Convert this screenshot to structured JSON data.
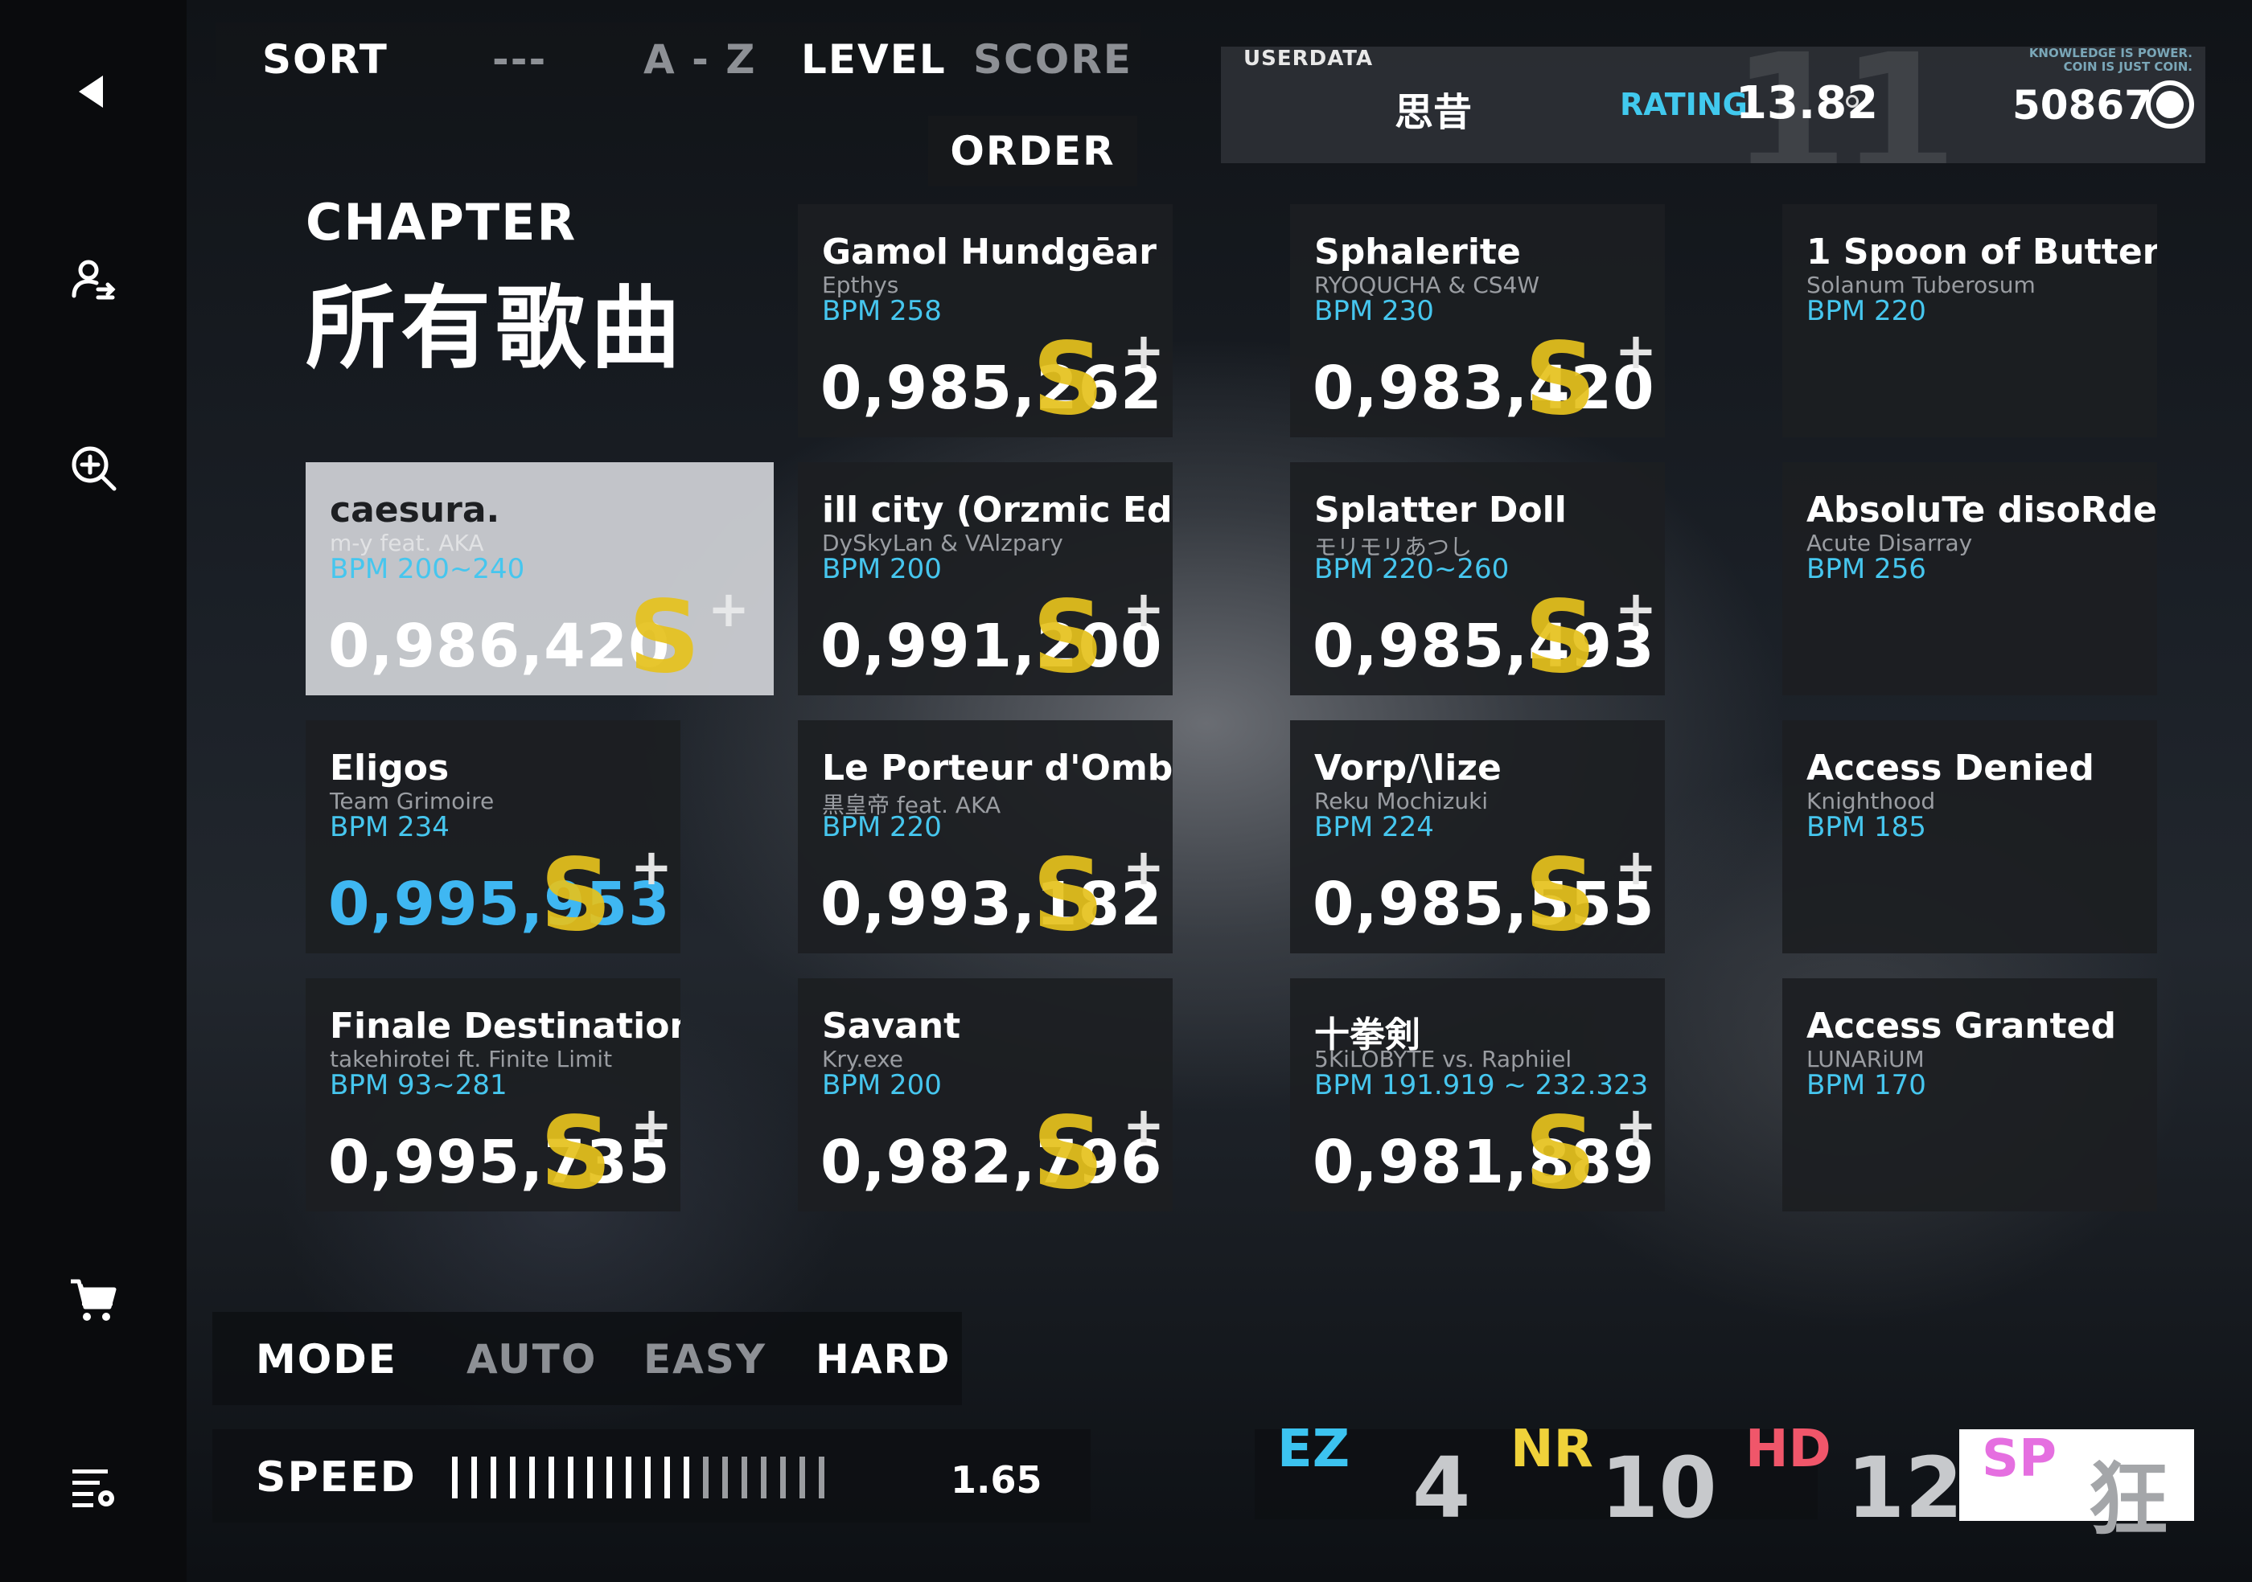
{
  "sidebar": {
    "icons": [
      "back-arrow-icon",
      "user-switch-icon",
      "zoom-in-icon",
      "cart-icon",
      "settings-list-icon"
    ]
  },
  "sort": {
    "label": "SORT",
    "options": [
      "---",
      "A - Z",
      "LEVEL",
      "SCORE"
    ],
    "active": "LEVEL",
    "order_label": "ORDER"
  },
  "userdata": {
    "label": "USERDATA",
    "name": "思昔",
    "rating_label": "RATING",
    "rating": "13.82",
    "background_level": "11",
    "motto_line1": "KNOWLEDGE IS POWER.",
    "motto_line2": "COIN IS JUST COIN.",
    "coins": "50867"
  },
  "chapter": {
    "label": "CHAPTER",
    "name": "所有歌曲"
  },
  "songs": [
    {
      "title": "Gamol Hundgēar",
      "artist": "Epthys",
      "bpm": "BPM 258",
      "score": "0,985,262",
      "rank": "S",
      "plus": "+"
    },
    {
      "title": "Sphalerite",
      "artist": "RYOQUCHA & CS4W",
      "bpm": "BPM 230",
      "score": "0,983,420",
      "rank": "S",
      "plus": "+"
    },
    {
      "title": "1 Spoon of Butter",
      "artist": "Solanum Tuberosum",
      "bpm": "BPM 220",
      "score": "",
      "rank": "",
      "plus": ""
    },
    {
      "title": "caesura.",
      "artist": "m-y feat. AKA",
      "bpm": "BPM 200~240",
      "score": "0,986,420",
      "rank": "S",
      "plus": "+"
    },
    {
      "title": "ill city (Orzmic Edit)",
      "artist": "DySkyLan & VAlzpary",
      "bpm": "BPM 200",
      "score": "0,991,200",
      "rank": "S",
      "plus": "+"
    },
    {
      "title": "Splatter Doll",
      "artist": "モリモリあつし",
      "bpm": "BPM 220~260",
      "score": "0,985,493",
      "rank": "S",
      "plus": "+"
    },
    {
      "title": "AbsoluTe disoRdeR",
      "artist": "Acute Disarray",
      "bpm": "BPM 256",
      "score": "",
      "rank": "",
      "plus": ""
    },
    {
      "title": "Eligos",
      "artist": "Team Grimoire",
      "bpm": "BPM 234",
      "score": "0,995,953",
      "rank": "S",
      "plus": "+"
    },
    {
      "title": "Le Porteur d'Ombre",
      "artist": "黒皇帝 feat. AKA",
      "bpm": "BPM 220",
      "score": "0,993,182",
      "rank": "S",
      "plus": "+"
    },
    {
      "title": "Vorp/\\lize",
      "artist": "Reku Mochizuki",
      "bpm": "BPM 224",
      "score": "0,985,555",
      "rank": "S",
      "plus": "+"
    },
    {
      "title": "Access Denied",
      "artist": "Knighthood",
      "bpm": "BPM 185",
      "score": "",
      "rank": "",
      "plus": ""
    },
    {
      "title": "Finale Destination",
      "artist": "takehirotei ft. Finite Limit",
      "bpm": "BPM 93~281",
      "score": "0,995,735",
      "rank": "S",
      "plus": "+"
    },
    {
      "title": "Savant",
      "artist": "Kry.exe",
      "bpm": "BPM 200",
      "score": "0,982,796",
      "rank": "S",
      "plus": "+"
    },
    {
      "title": "十拳剣",
      "artist": "5KiLOBYTE vs. Raphiiel",
      "bpm": "BPM 191.919 ~ 232.323",
      "score": "0,981,889",
      "rank": "S",
      "plus": "+"
    },
    {
      "title": "Access Granted",
      "artist": "LUNARiUM",
      "bpm": "BPM 170",
      "score": "",
      "rank": "",
      "plus": ""
    }
  ],
  "mode": {
    "label": "MODE",
    "options": [
      "AUTO",
      "EASY",
      "HARD"
    ],
    "active": "HARD"
  },
  "speed": {
    "label": "SPEED",
    "value": "1.65",
    "ticks_total": 20,
    "ticks_on": 13
  },
  "difficulties": [
    {
      "code": "EZ",
      "level": "4",
      "color": "#3cc3f0"
    },
    {
      "code": "NR",
      "level": "10",
      "color": "#f0d23a"
    },
    {
      "code": "HD",
      "level": "12",
      "color": "#f0566a"
    },
    {
      "code": "SP",
      "level": "狂",
      "color": "#e56fe0"
    }
  ],
  "colors": {
    "accent_blue": "#46c6ee",
    "rank_gold": "#e6c21d",
    "card_bg": "#1c1e22"
  }
}
